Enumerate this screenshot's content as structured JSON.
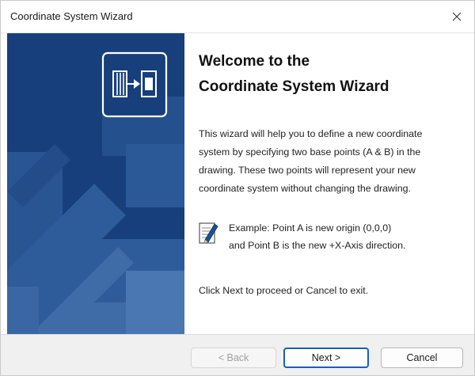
{
  "window": {
    "title": "Coordinate System Wizard",
    "close_icon": "close-icon"
  },
  "side_panel": {
    "logo_icon": "coordinate-system-wizard-icon",
    "background_color": "#173f7c"
  },
  "content": {
    "title_line1": "Welcome to the",
    "title_line2": "Coordinate System Wizard",
    "description_lines": [
      "This wizard will help you to define a new coordinate",
      "system by specifying two base points (A & B) in the",
      "drawing. These two points will represent your new",
      "coordinate system without changing the drawing."
    ],
    "example_icon": "notepad-pencil-icon",
    "example_lines": [
      "Example: Point A is new origin (0,0,0)",
      "and Point B is the new +X-Axis direction."
    ],
    "proceed_text": "Click Next to proceed or Cancel to exit."
  },
  "footer": {
    "back_label": "< Back",
    "next_label": "Next >",
    "cancel_label": "Cancel",
    "back_enabled": false,
    "default_button": "next"
  }
}
